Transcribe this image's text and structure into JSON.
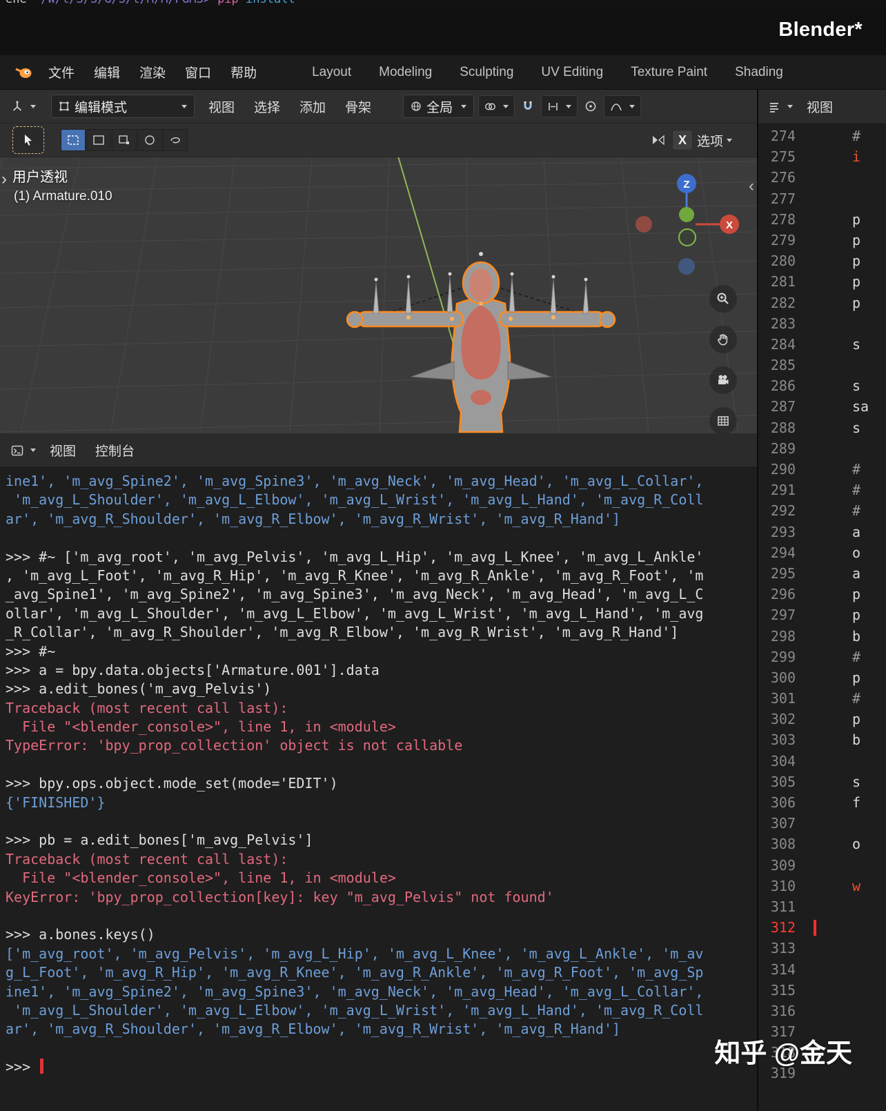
{
  "terminal": {
    "host": "ene ",
    "path": "~/W/l/S/S/G/S/t/M/M/PGMS> ",
    "cmd": "pip ",
    "arg": "install"
  },
  "titlebar": {
    "title": "Blender*"
  },
  "topbar": {
    "menus": [
      {
        "name": "menu-file",
        "label": "文件"
      },
      {
        "name": "menu-edit",
        "label": "编辑"
      },
      {
        "name": "menu-render",
        "label": "渲染"
      },
      {
        "name": "menu-window",
        "label": "窗口"
      },
      {
        "name": "menu-help",
        "label": "帮助"
      }
    ],
    "tabs": [
      {
        "name": "tab-layout",
        "label": "Layout"
      },
      {
        "name": "tab-modeling",
        "label": "Modeling"
      },
      {
        "name": "tab-sculpting",
        "label": "Sculpting"
      },
      {
        "name": "tab-uv-editing",
        "label": "UV Editing"
      },
      {
        "name": "tab-texture-paint",
        "label": "Texture Paint"
      },
      {
        "name": "tab-shading",
        "label": "Shading"
      }
    ]
  },
  "viewport_header": {
    "mode": "编辑模式",
    "menus": [
      {
        "name": "viewport-menu-view",
        "label": "视图"
      },
      {
        "name": "viewport-menu-select",
        "label": "选择"
      },
      {
        "name": "viewport-menu-add",
        "label": "添加"
      },
      {
        "name": "viewport-menu-armature",
        "label": "骨架"
      }
    ],
    "orientation": "全局",
    "mirror_axis": "X",
    "options": "选项"
  },
  "viewport": {
    "view_label": "用户透视",
    "object_label": "(1) Armature.010",
    "gizmo": {
      "z": "Z",
      "x": "X"
    }
  },
  "console": {
    "tabs": [
      {
        "name": "console-menu-view",
        "label": "视图"
      },
      {
        "name": "console-menu-console",
        "label": "控制台"
      }
    ],
    "lines": [
      {
        "t": "ine1', 'm_avg_Spine2', 'm_avg_Spine3', 'm_avg_Neck', 'm_avg_Head', 'm_avg_L_Collar',",
        "c": "out"
      },
      {
        "t": " 'm_avg_L_Shoulder', 'm_avg_L_Elbow', 'm_avg_L_Wrist', 'm_avg_L_Hand', 'm_avg_R_Coll",
        "c": "out"
      },
      {
        "t": "ar', 'm_avg_R_Shoulder', 'm_avg_R_Elbow', 'm_avg_R_Wrist', 'm_avg_R_Hand']",
        "c": "out"
      },
      {
        "t": "",
        "c": "in"
      },
      {
        "t": ">>> #~ ['m_avg_root', 'm_avg_Pelvis', 'm_avg_L_Hip', 'm_avg_L_Knee', 'm_avg_L_Ankle'",
        "c": "in"
      },
      {
        "t": ", 'm_avg_L_Foot', 'm_avg_R_Hip', 'm_avg_R_Knee', 'm_avg_R_Ankle', 'm_avg_R_Foot', 'm",
        "c": "in"
      },
      {
        "t": "_avg_Spine1', 'm_avg_Spine2', 'm_avg_Spine3', 'm_avg_Neck', 'm_avg_Head', 'm_avg_L_C",
        "c": "in"
      },
      {
        "t": "ollar', 'm_avg_L_Shoulder', 'm_avg_L_Elbow', 'm_avg_L_Wrist', 'm_avg_L_Hand', 'm_avg",
        "c": "in"
      },
      {
        "t": "_R_Collar', 'm_avg_R_Shoulder', 'm_avg_R_Elbow', 'm_avg_R_Wrist', 'm_avg_R_Hand']",
        "c": "in"
      },
      {
        "t": ">>> #~",
        "c": "in"
      },
      {
        "t": ">>> a = bpy.data.objects['Armature.001'].data",
        "c": "in"
      },
      {
        "t": ">>> a.edit_bones('m_avg_Pelvis')",
        "c": "in"
      },
      {
        "t": "Traceback (most recent call last):",
        "c": "err"
      },
      {
        "t": "  File \"<blender_console>\", line 1, in <module>",
        "c": "err"
      },
      {
        "t": "TypeError: 'bpy_prop_collection' object is not callable",
        "c": "err"
      },
      {
        "t": "",
        "c": "in"
      },
      {
        "t": ">>> bpy.ops.object.mode_set(mode='EDIT')",
        "c": "in"
      },
      {
        "t": "{'FINISHED'}",
        "c": "out"
      },
      {
        "t": "",
        "c": "in"
      },
      {
        "t": ">>> pb = a.edit_bones['m_avg_Pelvis']",
        "c": "in"
      },
      {
        "t": "Traceback (most recent call last):",
        "c": "err"
      },
      {
        "t": "  File \"<blender_console>\", line 1, in <module>",
        "c": "err"
      },
      {
        "t": "KeyError: 'bpy_prop_collection[key]: key \"m_avg_Pelvis\" not found'",
        "c": "err"
      },
      {
        "t": "",
        "c": "in"
      },
      {
        "t": ">>> a.bones.keys()",
        "c": "in"
      },
      {
        "t": "['m_avg_root', 'm_avg_Pelvis', 'm_avg_L_Hip', 'm_avg_L_Knee', 'm_avg_L_Ankle', 'm_av",
        "c": "out"
      },
      {
        "t": "g_L_Foot', 'm_avg_R_Hip', 'm_avg_R_Knee', 'm_avg_R_Ankle', 'm_avg_R_Foot', 'm_avg_Sp",
        "c": "out"
      },
      {
        "t": "ine1', 'm_avg_Spine2', 'm_avg_Spine3', 'm_avg_Neck', 'm_avg_Head', 'm_avg_L_Collar',",
        "c": "out"
      },
      {
        "t": " 'm_avg_L_Shoulder', 'm_avg_L_Elbow', 'm_avg_L_Wrist', 'm_avg_L_Hand', 'm_avg_R_Coll",
        "c": "out"
      },
      {
        "t": "ar', 'm_avg_R_Shoulder', 'm_avg_R_Elbow', 'm_avg_R_Wrist', 'm_avg_R_Hand']",
        "c": "out"
      },
      {
        "t": "",
        "c": "in"
      },
      {
        "t": ">>> ",
        "c": "in",
        "cursor": true
      }
    ]
  },
  "editor": {
    "header_menu": "视图",
    "active_line": "312",
    "lines": [
      {
        "n": "274",
        "t": "#",
        "k": "c"
      },
      {
        "n": "275",
        "t": "i",
        "k": "k"
      },
      {
        "n": "276"
      },
      {
        "n": "277"
      },
      {
        "n": "278",
        "t": "p",
        "k": "t"
      },
      {
        "n": "279",
        "t": "p",
        "k": "t"
      },
      {
        "n": "280",
        "t": "p",
        "k": "t"
      },
      {
        "n": "281",
        "t": "p",
        "k": "t"
      },
      {
        "n": "282",
        "t": "p",
        "k": "t"
      },
      {
        "n": "283"
      },
      {
        "n": "284",
        "t": "s",
        "k": "t"
      },
      {
        "n": "285"
      },
      {
        "n": "286",
        "t": "s",
        "k": "t"
      },
      {
        "n": "287",
        "t": "sa",
        "k": "t"
      },
      {
        "n": "288",
        "t": "s",
        "k": "t"
      },
      {
        "n": "289"
      },
      {
        "n": "290",
        "t": "#",
        "k": "c"
      },
      {
        "n": "291",
        "t": "#",
        "k": "c"
      },
      {
        "n": "292",
        "t": "#",
        "k": "c"
      },
      {
        "n": "293",
        "t": "a",
        "k": "t"
      },
      {
        "n": "294",
        "t": "o",
        "k": "t"
      },
      {
        "n": "295",
        "t": "a",
        "k": "t"
      },
      {
        "n": "296",
        "t": "p",
        "k": "t"
      },
      {
        "n": "297",
        "t": "p",
        "k": "t"
      },
      {
        "n": "298",
        "t": "b",
        "k": "t"
      },
      {
        "n": "299",
        "t": "#",
        "k": "c"
      },
      {
        "n": "300",
        "t": "p",
        "k": "t"
      },
      {
        "n": "301",
        "t": "#",
        "k": "c"
      },
      {
        "n": "302",
        "t": "p",
        "k": "t"
      },
      {
        "n": "303",
        "t": "b",
        "k": "t"
      },
      {
        "n": "304"
      },
      {
        "n": "305",
        "t": "s",
        "k": "t"
      },
      {
        "n": "306",
        "t": "f",
        "k": "t"
      },
      {
        "n": "307"
      },
      {
        "n": "308",
        "t": "o",
        "k": "t"
      },
      {
        "n": "309"
      },
      {
        "n": "310",
        "t": "w",
        "k": "k"
      },
      {
        "n": "311"
      },
      {
        "n": "312",
        "a": true
      },
      {
        "n": "313"
      },
      {
        "n": "314"
      },
      {
        "n": "315"
      },
      {
        "n": "316"
      },
      {
        "n": "317"
      },
      {
        "n": "318"
      },
      {
        "n": "319"
      }
    ]
  },
  "watermark": "知乎 @金天",
  "colors": {
    "accent_blue": "#4772b3",
    "selection_orange": "#ff8a1e",
    "console_output": "#6d9ed8",
    "console_error": "#e2697d",
    "active_line_red": "#ff3b30"
  }
}
